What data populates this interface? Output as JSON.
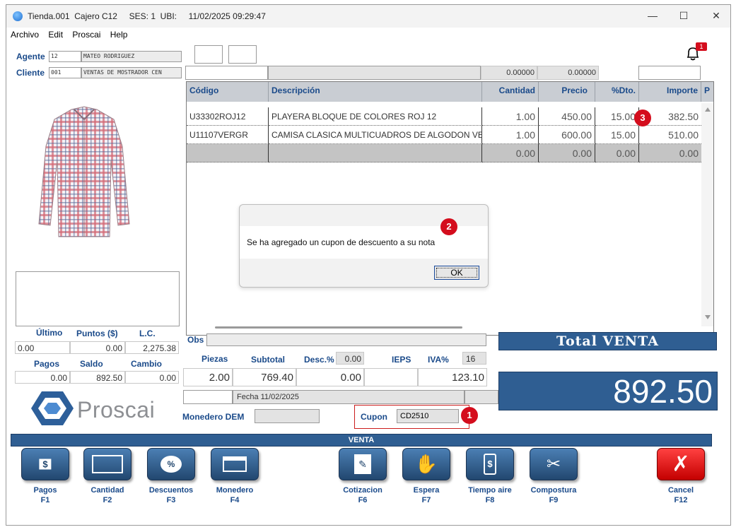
{
  "window": {
    "title": "Tienda.001  Cajero C12     SES: 1  UBI:     11/02/2025 09:29:47",
    "minimize": "—",
    "maximize": "☐",
    "close": "✕"
  },
  "menu": [
    "Archivo",
    "Edit",
    "Proscai",
    "Help"
  ],
  "agent": {
    "label": "Agente",
    "code": "12",
    "name": "MATEO RODRIGUEZ"
  },
  "client": {
    "label": "Cliente",
    "code": "001",
    "name": "VENTAS DE MOSTRADOR CEN"
  },
  "notification": {
    "count": "1"
  },
  "header_values": {
    "v1": "0.00000",
    "v2": "0.00000"
  },
  "grid": {
    "columns": [
      "Código",
      "Descripción",
      "Cantidad",
      "Precio",
      "%Dto.",
      "Importe",
      "P"
    ],
    "rows": [
      {
        "code": "U33302ROJ12",
        "desc": "PLAYERA BLOQUE DE COLORES ROJ 12",
        "qty": "1.00",
        "price": "450.00",
        "dto": "15.00",
        "importe": "382.50"
      },
      {
        "code": "U11107VERGR",
        "desc": "CAMISA CLASICA MULTICUADROS DE ALGODON VE",
        "qty": "1.00",
        "price": "600.00",
        "dto": "15.00",
        "importe": "510.00"
      },
      {
        "code": "",
        "desc": "",
        "qty": "0.00",
        "price": "0.00",
        "dto": "0.00",
        "importe": "0.00"
      }
    ]
  },
  "dialog": {
    "message": "Se ha agregado un cupon de descuento a su nota",
    "ok": "OK"
  },
  "badges": [
    "1",
    "2",
    "3"
  ],
  "stats": {
    "ultimo_label": "Último",
    "puntos_label": "Puntos ($)",
    "lc_label": "L.C.",
    "ultimo": "0.00",
    "puntos": "0.00",
    "lc": "2,275.38",
    "pagos_label": "Pagos",
    "saldo_label": "Saldo",
    "cambio_label": "Cambio",
    "pagos": "0.00",
    "saldo": "892.50",
    "cambio": "0.00"
  },
  "obs_label": "Obs",
  "summary": {
    "piezas_label": "Piezas",
    "subtotal_label": "Subtotal",
    "desc_label": "Desc.%",
    "desc_pct": "0.00",
    "ieps_label": "IEPS",
    "iva_label": "IVA%",
    "iva_pct": "16",
    "piezas": "2.00",
    "subtotal": "769.40",
    "desc": "0.00",
    "iva": "123.10"
  },
  "fecha": "Fecha 11/02/2025",
  "monedero_label": "Monedero DEM",
  "cupon": {
    "label": "Cupon",
    "value": "CD2510"
  },
  "total": {
    "label": "Total VENTA",
    "value": "892.50"
  },
  "logo": "Proscai",
  "section": "VENTA",
  "buttons": [
    {
      "label": "Pagos",
      "key": "F1"
    },
    {
      "label": "Cantidad",
      "key": "F2"
    },
    {
      "label": "Descuentos",
      "key": "F3"
    },
    {
      "label": "Monedero",
      "key": "F4"
    },
    {
      "label": "Cotizacion",
      "key": "F6"
    },
    {
      "label": "Espera",
      "key": "F7"
    },
    {
      "label": "Tiempo aire",
      "key": "F8"
    },
    {
      "label": "Compostura",
      "key": "F9"
    },
    {
      "label": "Cancel",
      "key": "F12"
    }
  ],
  "colors": {
    "accent": "#2f5e92",
    "badge": "#d40d1d",
    "label": "#1a4a8a"
  }
}
